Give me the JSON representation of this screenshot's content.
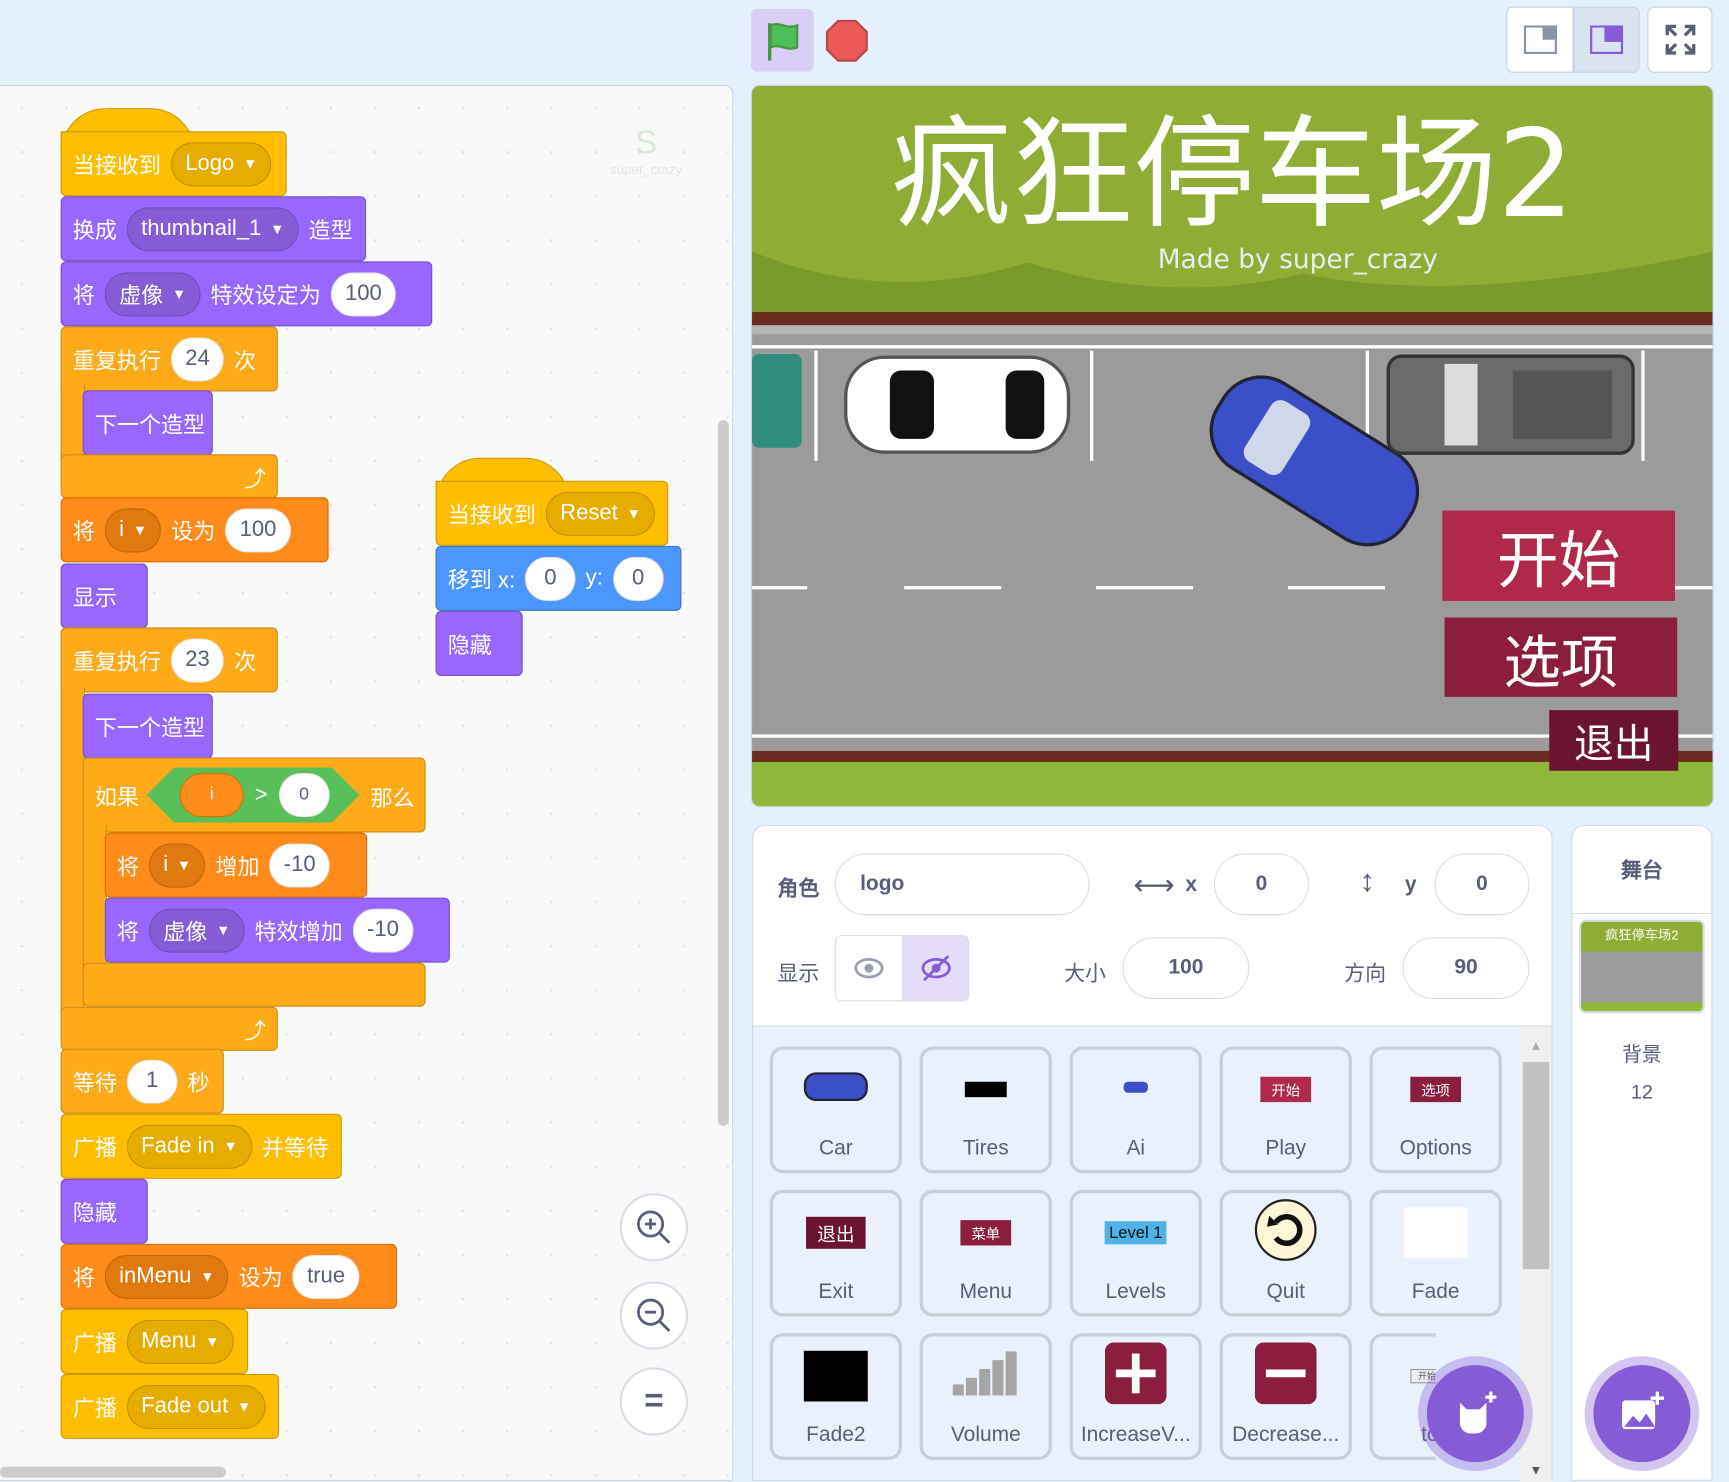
{
  "header": {
    "green_flag": "green-flag",
    "stop": "stop",
    "layout_small": "small-stage",
    "layout_normal": "normal-stage",
    "fullscreen": "fullscreen"
  },
  "code": {
    "s1": {
      "hat": {
        "label": "当接收到",
        "msg": "Logo"
      },
      "switch": {
        "a": "换成",
        "costume": "thumbnail_1",
        "b": "造型"
      },
      "seteffect": {
        "a": "将",
        "effect": "虚像",
        "b": "特效设定为",
        "val": "100"
      },
      "repeat1": {
        "a": "重复执行",
        "n": "24",
        "b": "次"
      },
      "next1": "下一个造型",
      "setvar": {
        "a": "将",
        "var": "i",
        "b": "设为",
        "val": "100"
      },
      "show": "显示",
      "repeat2": {
        "a": "重复执行",
        "n": "23",
        "b": "次"
      },
      "next2": "下一个造型",
      "if": {
        "a": "如果",
        "var": "i",
        "op": ">",
        "val": "0",
        "b": "那么"
      },
      "change": {
        "a": "将",
        "var": "i",
        "b": "增加",
        "val": "-10"
      },
      "changeeffect": {
        "a": "将",
        "effect": "虚像",
        "b": "特效增加",
        "val": "-10"
      },
      "wait": {
        "a": "等待",
        "n": "1",
        "b": "秒"
      },
      "bcastwait": {
        "a": "广播",
        "msg": "Fade in",
        "b": "并等待"
      },
      "hide": "隐藏",
      "setmenu": {
        "a": "将",
        "var": "inMenu",
        "b": "设为",
        "val": "true"
      },
      "bcast1": {
        "a": "广播",
        "msg": "Menu"
      },
      "bcast2": {
        "a": "广播",
        "msg": "Fade out"
      }
    },
    "s2": {
      "hat": {
        "label": "当接收到",
        "msg": "Reset"
      },
      "goto": {
        "a": "移到 x:",
        "x": "0",
        "b": "y:",
        "y": "0"
      },
      "hide": "隐藏"
    },
    "watermark": "super_crazy",
    "zoom": {
      "in": "zoom-in",
      "out": "zoom-out",
      "reset": "="
    }
  },
  "stage": {
    "title": "疯狂停车场2",
    "subtitle": "Made by super_crazy",
    "btn_start": "开始",
    "btn_options": "选项",
    "btn_exit": "退出",
    "colors": {
      "start": "#b0294a",
      "options": "#8b1e3f",
      "exit": "#6b1430",
      "grass": "#8fad35"
    }
  },
  "info": {
    "sprite_label": "角色",
    "sprite_name": "logo",
    "x_label": "x",
    "x": "0",
    "y_label": "y",
    "y": "0",
    "show_label": "显示",
    "size_label": "大小",
    "size": "100",
    "dir_label": "方向",
    "dir": "90"
  },
  "sprites": [
    {
      "name": "Car"
    },
    {
      "name": "Tires"
    },
    {
      "name": "Ai"
    },
    {
      "name": "Play",
      "thumb": "开始"
    },
    {
      "name": "Options",
      "thumb": "选项"
    },
    {
      "name": "Exit",
      "thumb": "退出"
    },
    {
      "name": "Menu",
      "thumb": "菜单"
    },
    {
      "name": "Levels",
      "thumb": "Level 1"
    },
    {
      "name": "Quit"
    },
    {
      "name": "Fade"
    },
    {
      "name": "Fade2"
    },
    {
      "name": "Volume"
    },
    {
      "name": "IncreaseV..."
    },
    {
      "name": "Decrease..."
    },
    {
      "name": "tou",
      "thumb": "开始按钮"
    }
  ],
  "stage_panel": {
    "title": "舞台",
    "thumb_title": "疯狂停车场2",
    "backdrops_label": "背景",
    "backdrops_count": "12"
  }
}
